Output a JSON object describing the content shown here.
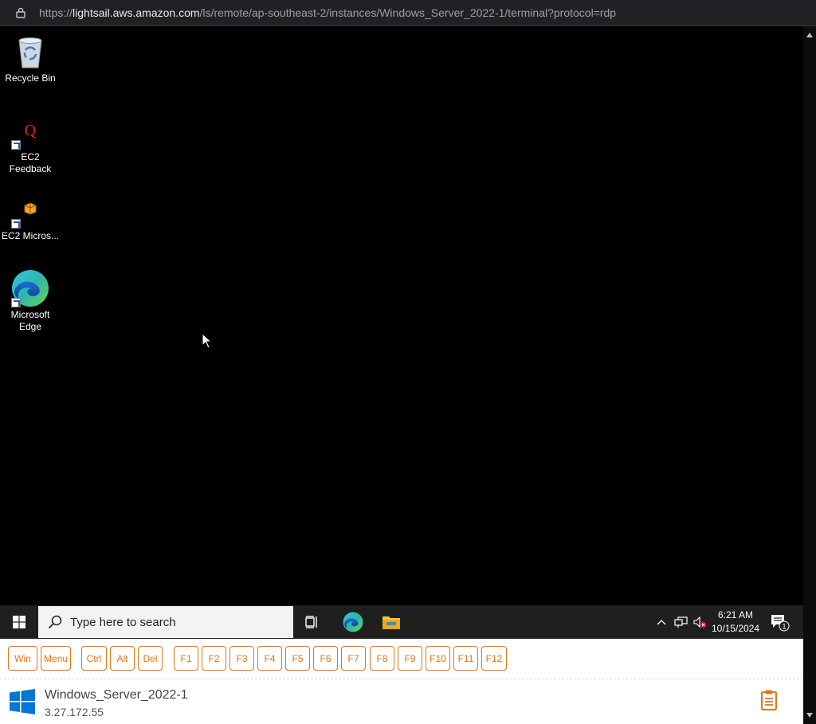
{
  "browser": {
    "url_scheme": "https://",
    "url_host": "lightsail.aws.amazon.com",
    "url_path": "/ls/remote/ap-southeast-2/instances/Windows_Server_2022-1/terminal?protocol=rdp"
  },
  "desktop": {
    "icons": [
      {
        "label": "Recycle Bin",
        "icon": "recycle-bin-icon"
      },
      {
        "label": "EC2 Feedback",
        "icon": "ec2-feedback-icon"
      },
      {
        "label": "EC2 Micros...",
        "icon": "ec2-microsoft-icon"
      },
      {
        "label": "Microsoft Edge",
        "icon": "edge-icon"
      }
    ]
  },
  "taskbar": {
    "search_placeholder": "Type here to search",
    "time": "6:21 AM",
    "date": "10/15/2024",
    "notification_count": "1"
  },
  "keys": [
    "Win",
    "Menu",
    "Ctrl",
    "Alt",
    "Del",
    "F1",
    "F2",
    "F3",
    "F4",
    "F5",
    "F6",
    "F7",
    "F8",
    "F9",
    "F10",
    "F11",
    "F12"
  ],
  "instance": {
    "name": "Windows_Server_2022-1",
    "ip": "3.27.172.55"
  },
  "colors": {
    "accent": "#ec7211",
    "windows_blue": "#0078d4"
  }
}
